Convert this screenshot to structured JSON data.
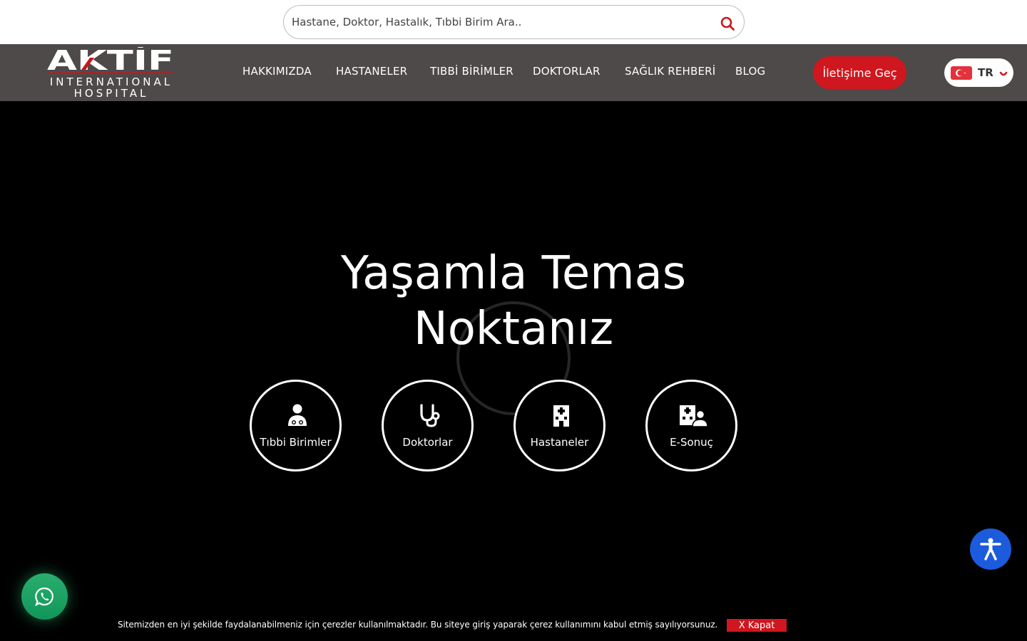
{
  "search": {
    "placeholder": "Hastane, Doktor, Hastalık, Tıbbi Birim Ara.."
  },
  "logo": {
    "brand": "AKTİF",
    "line1": "INTERNATIONAL",
    "line2": "HOSPITAL"
  },
  "nav": {
    "items": [
      {
        "label": "HAKKIMIZDA"
      },
      {
        "label": "HASTANELER"
      },
      {
        "label": "TIBBİ BİRİMLER"
      },
      {
        "label": "DOKTORLAR"
      },
      {
        "label": "SAĞLIK REHBERİ"
      },
      {
        "label": "BLOG"
      }
    ],
    "contact_button": "İletişime Geç",
    "language": {
      "code": "TR",
      "flag_icon": "turkey-flag-icon"
    }
  },
  "hero": {
    "title_line1": "Yaşamla Temas",
    "title_line2": "Noktanız",
    "quick_links": [
      {
        "label": "Tıbbi Birimler",
        "icon": "doctor-icon"
      },
      {
        "label": "Doktorlar",
        "icon": "stethoscope-icon"
      },
      {
        "label": "Hastaneler",
        "icon": "hospital-icon"
      },
      {
        "label": "E-Sonuç",
        "icon": "clinic-user-icon"
      }
    ]
  },
  "cookie": {
    "text": "Sitemizden en iyi şekilde faydalanabilmeniz için çerezler kullanılmaktadır. Bu siteye giriş yaparak çerez kullanımını kabul etmiş sayılıyorsunuz.",
    "close_label": "X Kapat"
  },
  "colors": {
    "brand_red": "#d0161e",
    "nav_bg": "#4d4a49",
    "accessibility_blue": "#1b5bdc",
    "whatsapp_green": "#1fa464"
  }
}
